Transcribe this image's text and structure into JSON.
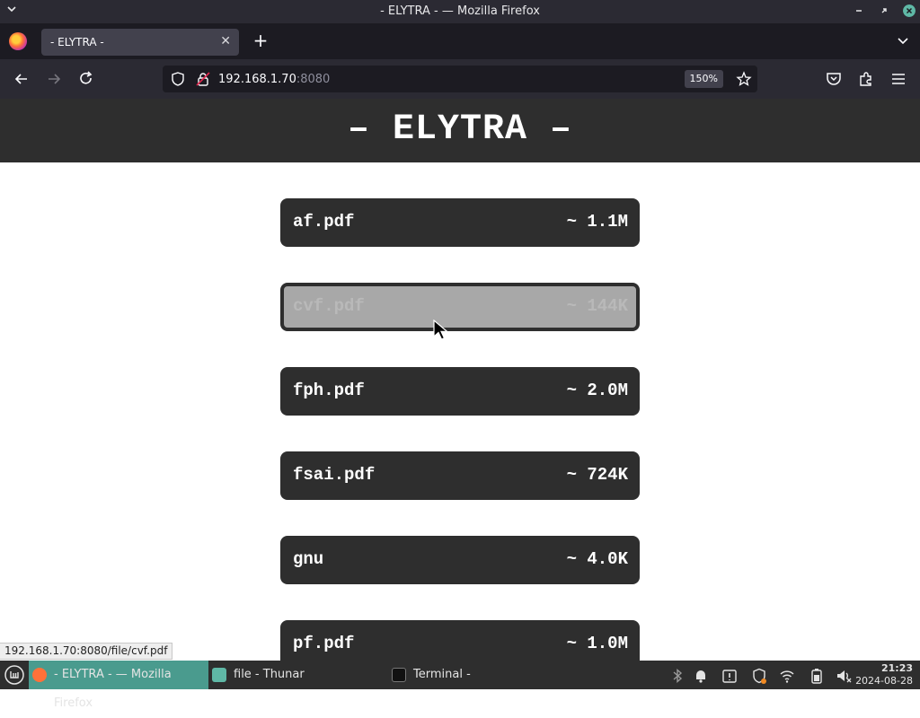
{
  "window": {
    "title": "- ELYTRA - — Mozilla Firefox"
  },
  "browser": {
    "tab_title": "- ELYTRA -",
    "url_host": "192.168.1.70",
    "url_port": ":8080",
    "zoom": "150%"
  },
  "page": {
    "heading": "– ELYTRA –",
    "files": [
      {
        "name": "af.pdf",
        "size": "~ 1.1M",
        "hovered": false
      },
      {
        "name": "cvf.pdf",
        "size": "~ 144K",
        "hovered": true
      },
      {
        "name": "fph.pdf",
        "size": "~ 2.0M",
        "hovered": false
      },
      {
        "name": "fsai.pdf",
        "size": "~ 724K",
        "hovered": false
      },
      {
        "name": "gnu",
        "size": "~ 4.0K",
        "hovered": false
      },
      {
        "name": "pf.pdf",
        "size": "~ 1.0M",
        "hovered": false
      }
    ]
  },
  "status_url": "192.168.1.70:8080/file/cvf.pdf",
  "taskbar": {
    "items": [
      {
        "label": "- ELYTRA - — Mozilla Firefox",
        "active": true
      },
      {
        "label": "file - Thunar",
        "active": false
      },
      {
        "label": "Terminal -",
        "active": false
      }
    ],
    "time": "21:23",
    "date": "2024-08-28"
  },
  "colors": {
    "accent": "#4a9b8e",
    "header_bg": "#2e2e2e",
    "file_bg": "#2e2e2e",
    "file_hover_bg": "#a8a8a8"
  }
}
